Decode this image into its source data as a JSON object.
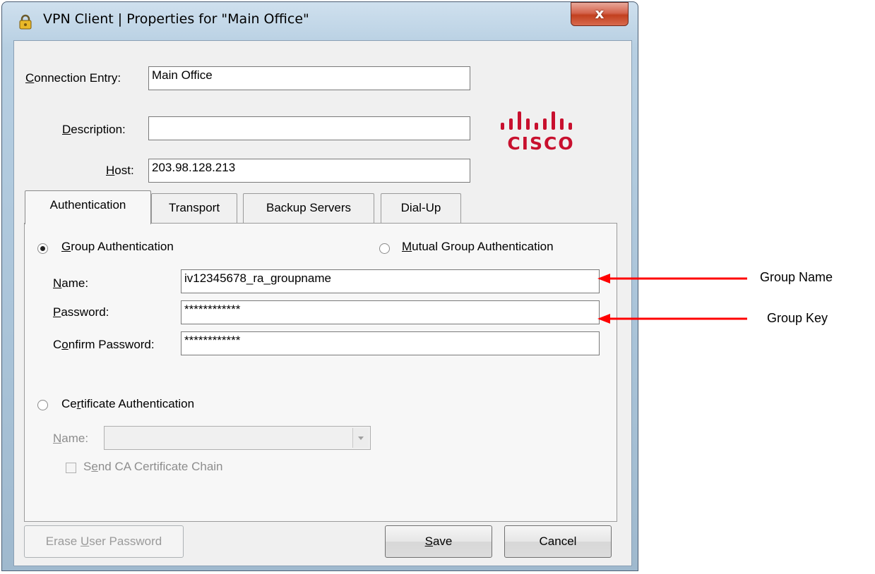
{
  "window": {
    "title": "VPN Client  |  Properties for \"Main Office\"",
    "close_glyph": "x"
  },
  "connection": {
    "entry_label_prefix": "C",
    "entry_label_rest": "onnection Entry:",
    "entry_value": "Main Office",
    "description_label_prefix": "D",
    "description_label_rest": "escription:",
    "description_value": "",
    "host_label_prefix": "H",
    "host_label_rest": "ost:",
    "host_value": "203.98.128.213"
  },
  "logo": {
    "text": "CISCO",
    "color": "#c8102e"
  },
  "tabs": [
    {
      "label": "Authentication"
    },
    {
      "label": "Transport"
    },
    {
      "label": "Backup Servers"
    },
    {
      "label": "Dial-Up"
    }
  ],
  "auth": {
    "group_auth_prefix": "G",
    "group_auth_rest": "roup Authentication",
    "mutual_auth_prefix": "M",
    "mutual_auth_rest": "utual Group Authentication",
    "name_label_prefix": "N",
    "name_label_rest": "ame:",
    "name_value": "iv12345678_ra_groupname",
    "password_label_prefix": "P",
    "password_label_rest": "assword:",
    "password_value": "************",
    "confirm_label_a": "C",
    "confirm_label_u": "o",
    "confirm_label_b": "nfirm Password:",
    "confirm_value": "************",
    "cert_auth_a": "Ce",
    "cert_auth_u": "r",
    "cert_auth_b": "tificate Authentication",
    "cert_name_prefix": "N",
    "cert_name_rest": "ame:",
    "send_ca_a": "S",
    "send_ca_u": "e",
    "send_ca_b": "nd CA Certificate Chain"
  },
  "buttons": {
    "erase_a": "Erase ",
    "erase_u": "U",
    "erase_b": "ser Password",
    "save_u": "S",
    "save_b": "ave",
    "cancel": "Cancel"
  },
  "annotations": {
    "group_name": "Group Name",
    "group_key": "Group Key",
    "arrow_color": "#ff0000"
  }
}
